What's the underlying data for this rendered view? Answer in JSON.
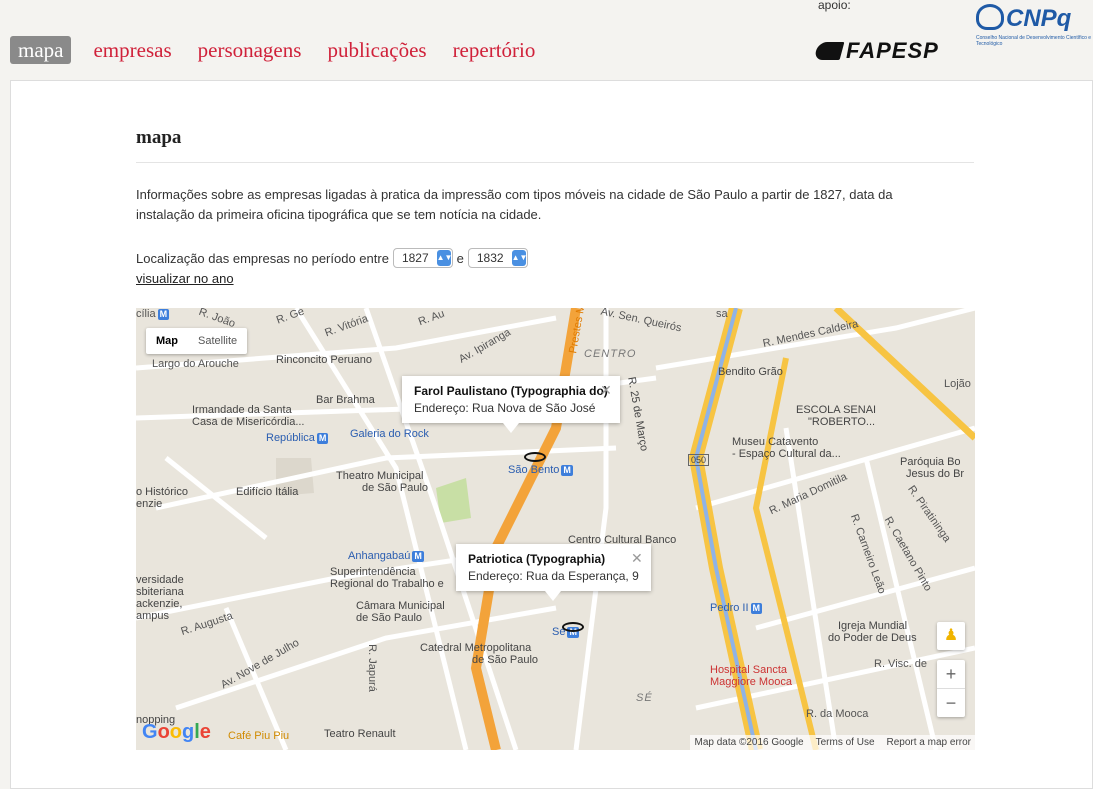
{
  "nav": {
    "items": [
      {
        "label": "mapa",
        "active": true
      },
      {
        "label": "empresas",
        "active": false
      },
      {
        "label": "personagens",
        "active": false
      },
      {
        "label": "publicações",
        "active": false
      },
      {
        "label": "repertório",
        "active": false
      }
    ]
  },
  "sponsors": {
    "apoio_label": "apoio:",
    "fapesp": "FAPESP",
    "cnpq": "CNPq",
    "cnpq_sub": "Conselho Nacional de Desenvolvimento Científico e Tecnológico"
  },
  "page": {
    "title": "mapa",
    "description": "Informações sobre as empresas ligadas à pratica da impressão com tipos móveis na cidade de São Paulo a partir de 1827, data da instalação da primeira oficina tipográfica que se tem notícia na cidade.",
    "filter_label": "Localização das empresas no período entre",
    "filter_joiner": "e",
    "year_from": "1827",
    "year_to": "1832",
    "year_link": "visualizar no ano"
  },
  "map": {
    "type_buttons": {
      "map": "Map",
      "satellite": "Satellite"
    },
    "labels": {
      "largo_arouche": "Largo do Arouche",
      "rinconcito": "Rinconcito Peruano",
      "irmandade": "Irmandade da Santa",
      "casa": "Casa de Misericórdia...",
      "republica": "República",
      "galeria": "Galeria do Rock",
      "bar_brahma": "Bar Brahma",
      "theatro": "Theatro Municipal",
      "theatro2": "de São Paulo",
      "edificio": "Edifício Itália",
      "historico": "o Histórico",
      "enzie": "enzie",
      "anhangabau": "Anhangabaú",
      "superintendencia": "Superintendência",
      "regional": "Regional do Trabalho e",
      "versidade": "versidade",
      "sbiteriana": "sbiteriana",
      "ackenzie": "ackenzie,",
      "ampus": "ampus",
      "r_augusta": "R. Augusta",
      "camara": "Câmara Municipal",
      "camara2": "de São Paulo",
      "catedral": "Catedral Metropolitana",
      "catedral2": "de São Paulo",
      "se": "Sé",
      "se_big": "SÉ",
      "centro": "CENTRO",
      "sao_bento": "São Bento",
      "centro_cultural": "Centro Cultural Banco",
      "bendito": "Bendito Grão",
      "escola": "ESCOLA SENAI",
      "roberto": "\"ROBERTO...",
      "museu": "Museu Catavento",
      "espaco": "- Espaço Cultural da...",
      "paroquia": "Paróquia Bo",
      "jesus": "Jesus do Br",
      "lojao": "Lojão",
      "r_maria": "R. Maria Domitila",
      "r_mendes": "R. Mendes Caldeira",
      "r_vitoria": "R. Vitória",
      "av_ipiranga": "Av. Ipiranga",
      "av_sen": "Av. Sen. Queirós",
      "pedro": "Pedro II",
      "igreja": "Igreja Mundial",
      "igreja2": "do Poder de Deus",
      "hospital": "Hospital Sancta",
      "maggiore": "Maggiore Mooca",
      "r_mooca": "R. da Mooca",
      "r_visc": "R. Visc. de",
      "av_nove": "Av. Nove de Julho",
      "r_japura": "R. Japurá",
      "teatro_renault": "Teatro Renault",
      "cafe": "Café Piu Piu",
      "nopping": "nopping",
      "cilia": "cília",
      "r_25": "R. 25 de Março",
      "r_carneiro": "R. Carneiro Leão",
      "r_caetano": "R. Caetano Pinto",
      "r_piratininga": "R. Piratininga",
      "r_joao": "R. João",
      "r_ge": "R. Ge",
      "r_au": "R. Au",
      "prestes": "Prestes Ma",
      "ed_050": "050",
      "sa": "sa"
    },
    "info_windows": [
      {
        "name": "Farol Paulistano (Typographia do)",
        "address": "Endereço: Rua Nova de São José"
      },
      {
        "name": "Patriotica (Typographia)",
        "address": "Endereço: Rua da Esperança, 9"
      }
    ],
    "google": "Google",
    "attribution": {
      "data": "Map data ©2016 Google",
      "terms": "Terms of Use",
      "report": "Report a map error"
    },
    "colors": {
      "highway": "#f7c443",
      "highway_orange": "#f3a33a",
      "road": "#ffffff",
      "park": "#c8dfa5",
      "metro_blue": "#3d7edb",
      "land": "#e9e5dc"
    }
  }
}
